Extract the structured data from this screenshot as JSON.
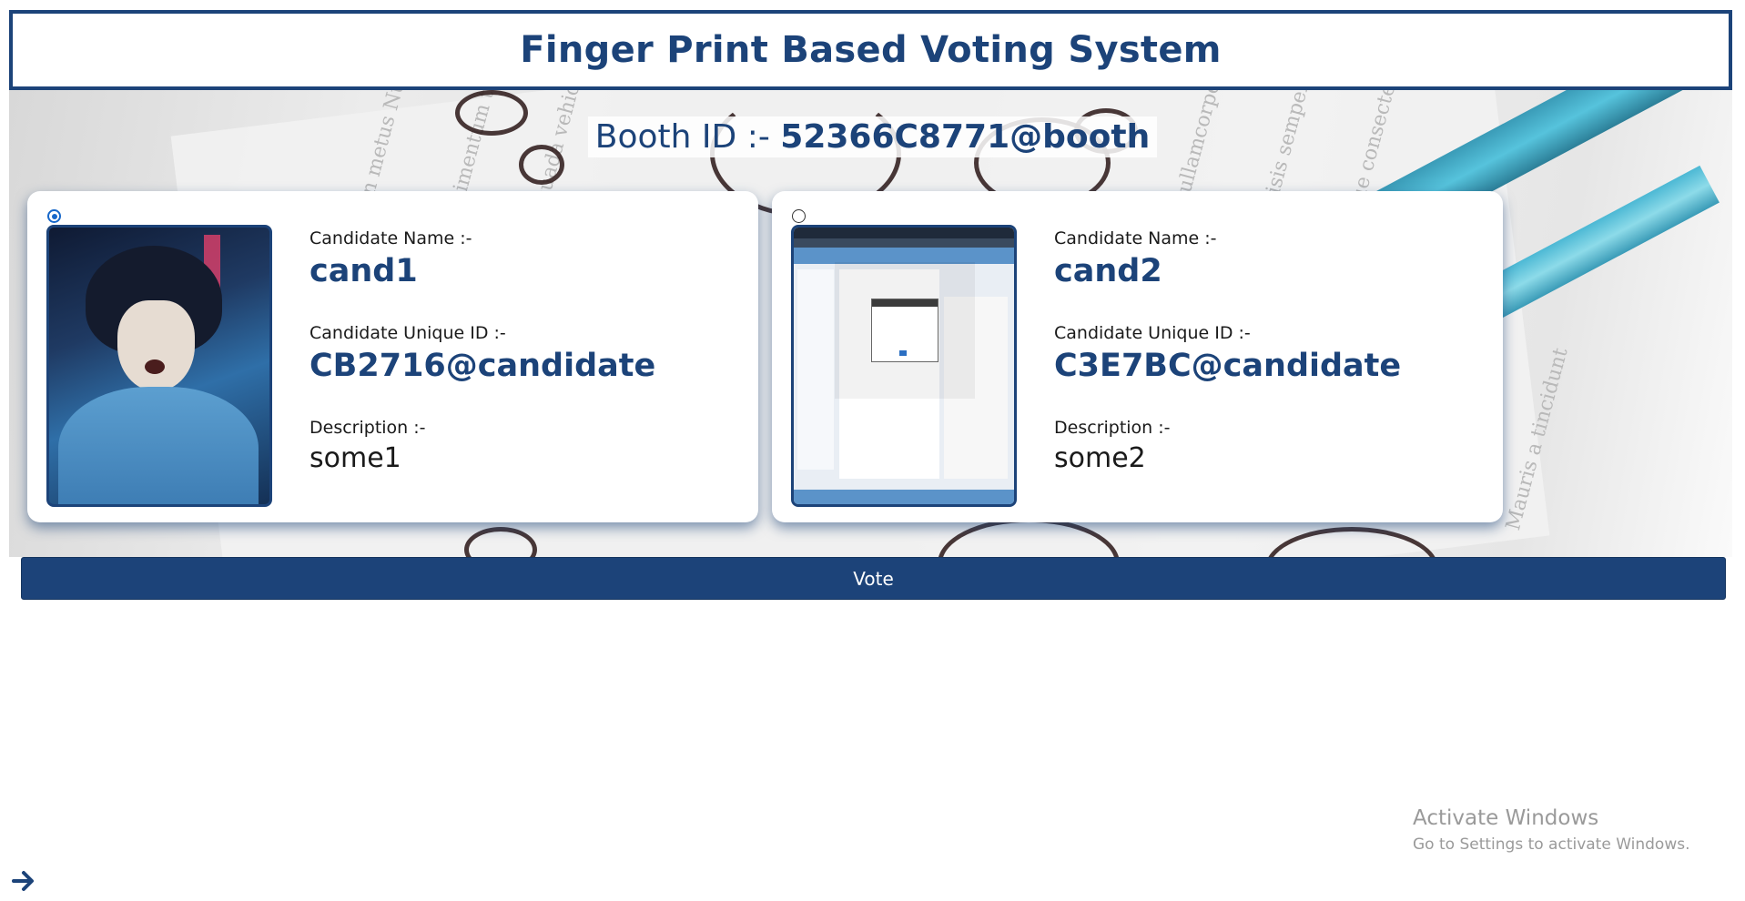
{
  "header": {
    "title": "Finger Print Based Voting System"
  },
  "booth": {
    "label": "Booth ID :- ",
    "id": "52366C8771@booth"
  },
  "candidates": [
    {
      "selected": true,
      "photo_icon": "anime-portrait-image",
      "name_label": "Candidate Name :-",
      "name": "cand1",
      "uid_label": "Candidate Unique ID :-",
      "uid": "CB2716@candidate",
      "desc_label": "Description :-",
      "desc": "some1"
    },
    {
      "selected": false,
      "photo_icon": "screenshot-image",
      "name_label": "Candidate Name :-",
      "name": "cand2",
      "uid_label": "Candidate Unique ID :-",
      "uid": "C3E7BC@candidate",
      "desc_label": "Description :-",
      "desc": "some2"
    }
  ],
  "vote_button": {
    "label": "Vote"
  },
  "watermark": {
    "line1": "Activate Windows",
    "line2": "Go to Settings to activate Windows."
  },
  "nav": {
    "arrow_icon": "arrow-right-icon"
  },
  "colors": {
    "primary": "#1c4379",
    "radio_checked": "#1667c9"
  }
}
